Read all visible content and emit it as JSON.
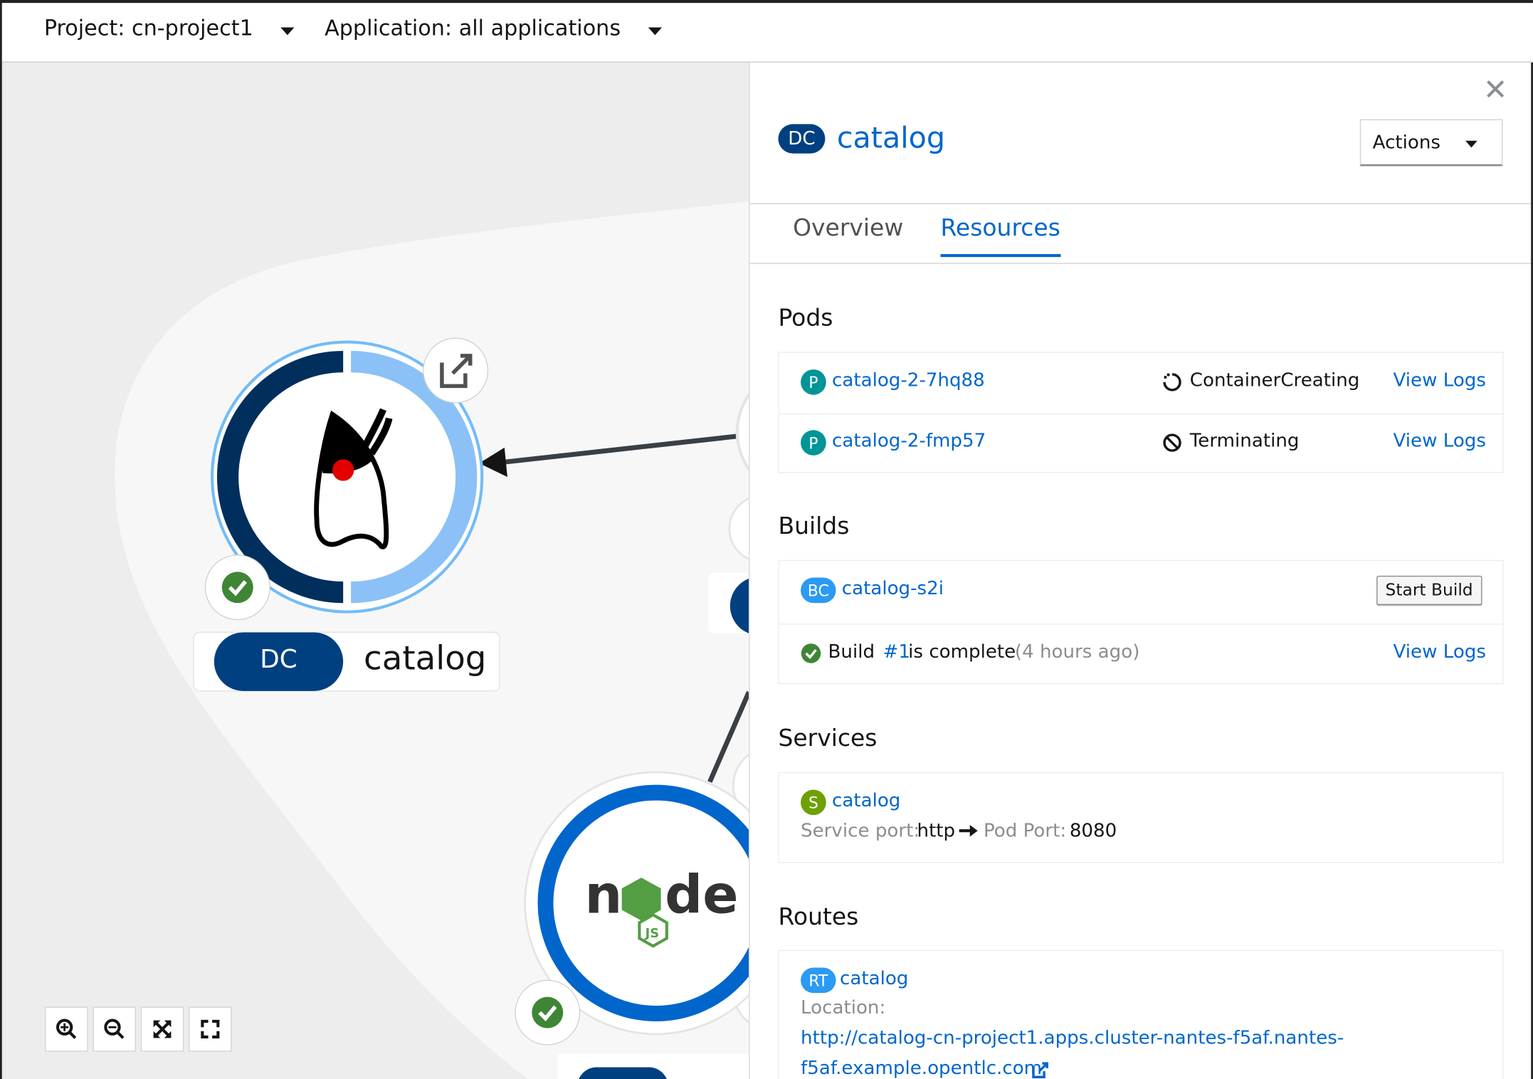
{
  "topbar": {
    "project_label": "Project: cn-project1",
    "application_label": "Application: all applications"
  },
  "topology": {
    "catalog_node": {
      "badge": "DC",
      "name": "catalog",
      "status": "ok"
    },
    "nodejs_node": {
      "logo": "nodejs-logo",
      "status": "ok"
    },
    "zoom_controls": [
      "zoom-in-icon",
      "zoom-out-icon",
      "reset-view-icon",
      "fit-to-screen-icon"
    ]
  },
  "panel": {
    "badge": "DC",
    "title": "catalog",
    "actions_label": "Actions",
    "tabs": [
      {
        "label": "Overview",
        "active": false
      },
      {
        "label": "Resources",
        "active": true
      }
    ],
    "pods": {
      "heading": "Pods",
      "items": [
        {
          "badge": "P",
          "name": "catalog-2-7hq88",
          "status": "ContainerCreating",
          "logs": "View Logs"
        },
        {
          "badge": "P",
          "name": "catalog-2-fmp57",
          "status": "Terminating",
          "logs": "View Logs"
        }
      ]
    },
    "builds": {
      "heading": "Builds",
      "badge": "BC",
      "name": "catalog-s2i",
      "start_button": "Start Build",
      "build_prefix": "Build",
      "build_number": "#1",
      "build_status": "is complete",
      "build_time": "(4 hours ago)",
      "logs": "View Logs"
    },
    "services": {
      "heading": "Services",
      "badge": "S",
      "name": "catalog",
      "service_port_label": "Service port:",
      "service_port": "http",
      "pod_port_label": "Pod Port:",
      "pod_port": "8080"
    },
    "routes": {
      "heading": "Routes",
      "badge": "RT",
      "name": "catalog",
      "location_label": "Location:",
      "url_line1": "http://catalog-cn-project1.apps.cluster-nantes-f5af.nantes-",
      "url_line2": "f5af.example.opentlc.com"
    }
  },
  "colors": {
    "link": "#0066cc",
    "dc_badge": "#004080",
    "pod_badge": "#009596",
    "bc_badge": "#2b9af3",
    "service_badge": "#6ca100",
    "success": "#3e8635"
  }
}
